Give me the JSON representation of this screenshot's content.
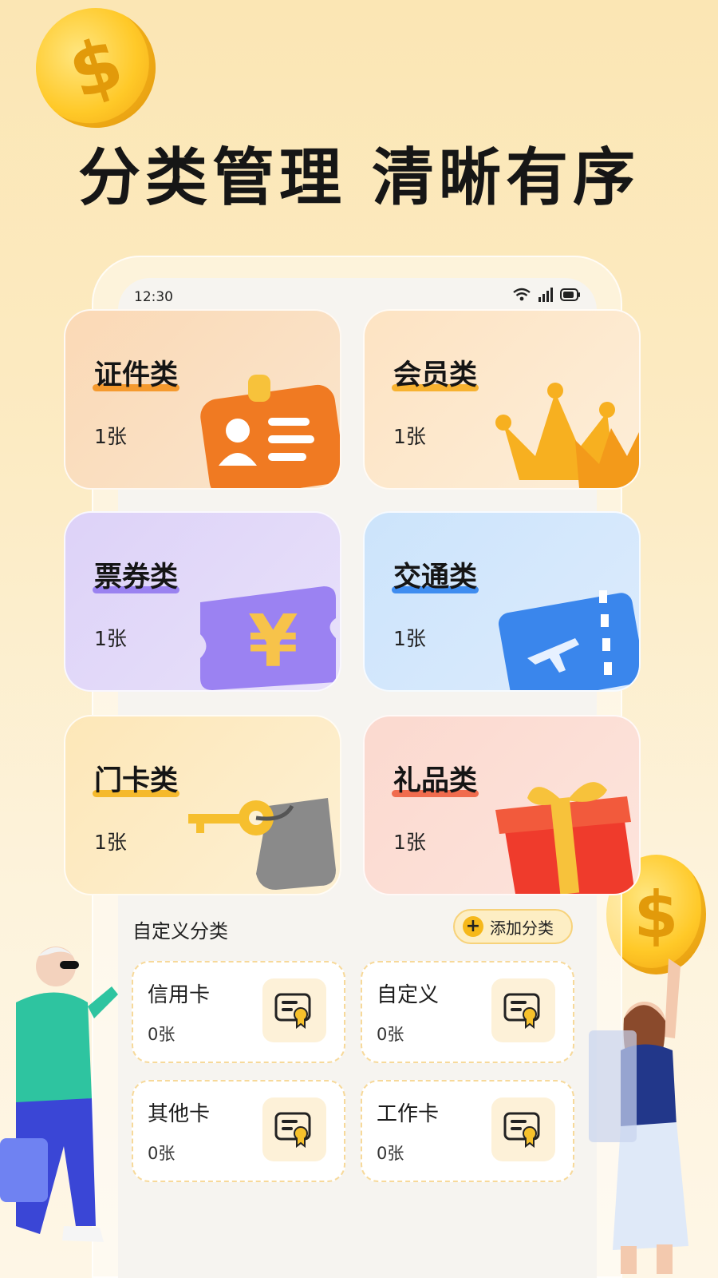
{
  "headline": {
    "left": "分类管理",
    "right": "清晰有序"
  },
  "status_bar": {
    "time": "12:30"
  },
  "categories": [
    {
      "name": "证件类",
      "count": "1张",
      "art": "id-badge-icon"
    },
    {
      "name": "会员类",
      "count": "1张",
      "art": "crown-icon"
    },
    {
      "name": "票券类",
      "count": "1张",
      "art": "yuan-ticket-icon"
    },
    {
      "name": "交通类",
      "count": "1张",
      "art": "plane-ticket-icon"
    },
    {
      "name": "门卡类",
      "count": "1张",
      "art": "key-tag-icon"
    },
    {
      "name": "礼品类",
      "count": "1张",
      "art": "gift-box-icon"
    }
  ],
  "custom": {
    "title": "自定义分类",
    "add_button": "添加分类",
    "items": [
      {
        "name": "信用卡",
        "count": "0张"
      },
      {
        "name": "自定义",
        "count": "0张"
      },
      {
        "name": "其他卡",
        "count": "0张"
      },
      {
        "name": "工作卡",
        "count": "0张"
      }
    ]
  },
  "colors": {
    "accent": "#f6b81a",
    "background": "#fbe6b4"
  }
}
